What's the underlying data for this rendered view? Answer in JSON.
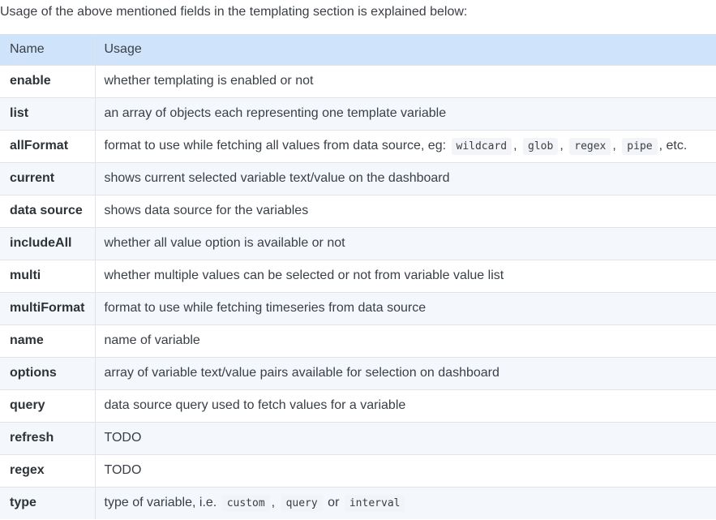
{
  "intro": "Usage of the above mentioned fields in the templating section is explained below:",
  "table": {
    "headers": {
      "name": "Name",
      "usage": "Usage"
    },
    "rows": [
      {
        "name": "enable",
        "usage": "whether templating is enabled or not"
      },
      {
        "name": "list",
        "usage": "an array of objects each representing one template variable"
      },
      {
        "name": "allFormat",
        "usage_prefix": "format to use while fetching all values from data source, eg:",
        "codes": [
          "wildcard",
          "glob",
          "regex",
          "pipe"
        ],
        "separator": ",",
        "usage_suffix": ", etc."
      },
      {
        "name": "current",
        "usage": "shows current selected variable text/value on the dashboard"
      },
      {
        "name": "data source",
        "usage": "shows data source for the variables"
      },
      {
        "name": "includeAll",
        "usage": "whether all value option is available or not"
      },
      {
        "name": "multi",
        "usage": "whether multiple values can be selected or not from variable value list"
      },
      {
        "name": "multiFormat",
        "usage": "format to use while fetching timeseries from data source"
      },
      {
        "name": "name",
        "usage": "name of variable"
      },
      {
        "name": "options",
        "usage": "array of variable text/value pairs available for selection on dashboard"
      },
      {
        "name": "query",
        "usage": "data source query used to fetch values for a variable"
      },
      {
        "name": "refresh",
        "usage": "TODO"
      },
      {
        "name": "regex",
        "usage": "TODO"
      },
      {
        "name": "type",
        "usage_prefix": "type of variable, i.e.",
        "codes": [
          "custom",
          "query",
          "interval"
        ],
        "separator": ",",
        "or_word": "or"
      }
    ]
  }
}
